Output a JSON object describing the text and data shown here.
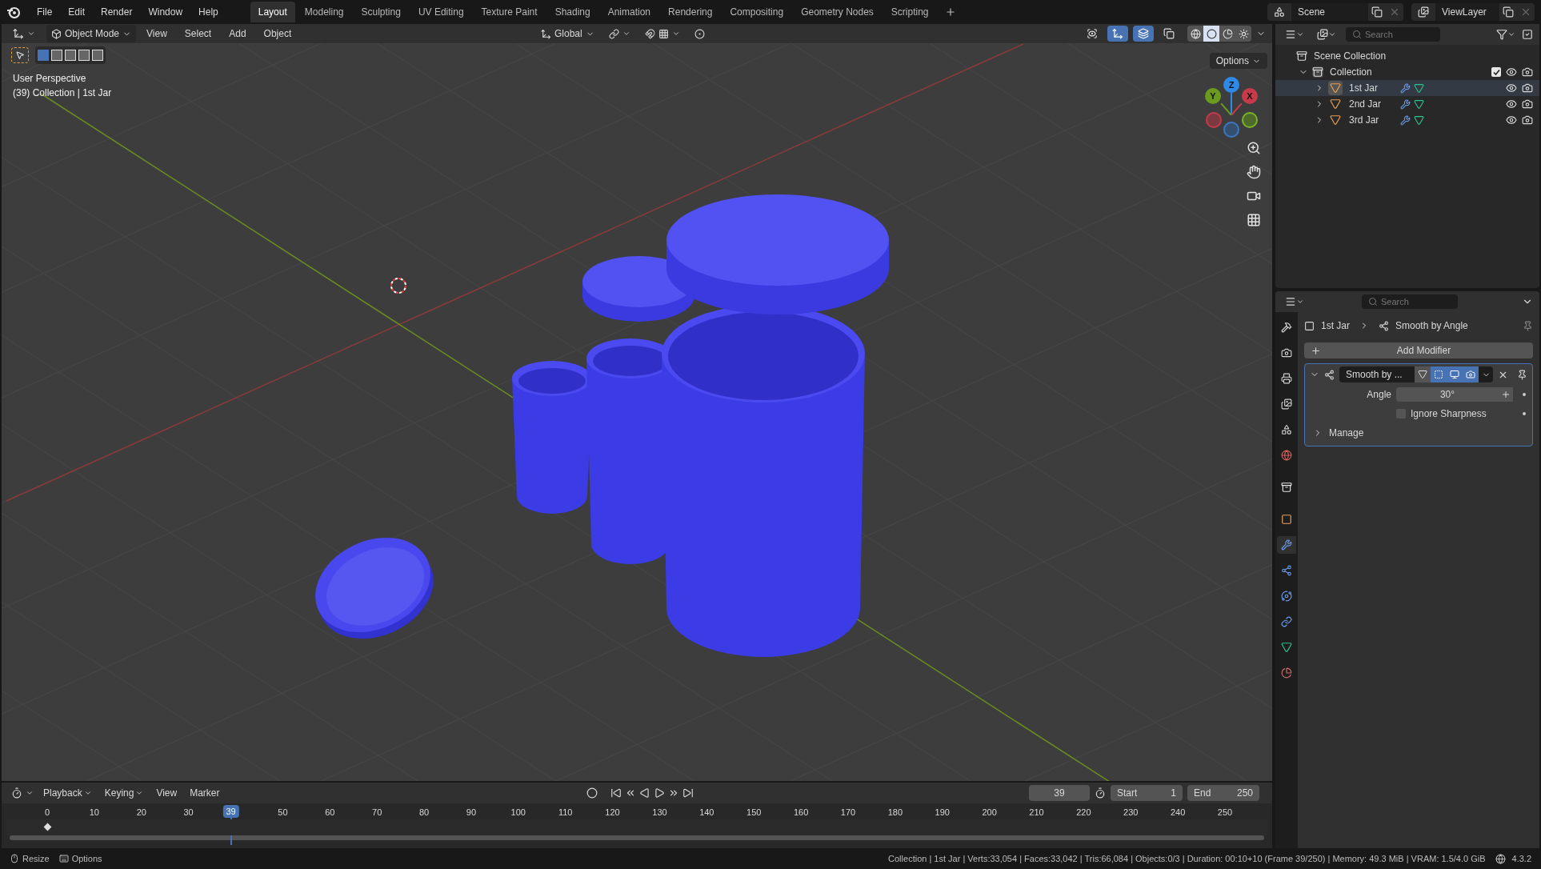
{
  "menu_bar": {
    "menus": [
      "File",
      "Edit",
      "Render",
      "Window",
      "Help"
    ],
    "workspaces": [
      {
        "label": "Layout",
        "selected": true
      },
      {
        "label": "Modeling",
        "selected": false
      },
      {
        "label": "Sculpting",
        "selected": false
      },
      {
        "label": "UV Editing",
        "selected": false
      },
      {
        "label": "Texture Paint",
        "selected": false
      },
      {
        "label": "Shading",
        "selected": false
      },
      {
        "label": "Animation",
        "selected": false
      },
      {
        "label": "Rendering",
        "selected": false
      },
      {
        "label": "Compositing",
        "selected": false
      },
      {
        "label": "Geometry Nodes",
        "selected": false
      },
      {
        "label": "Scripting",
        "selected": false
      }
    ],
    "scene": "Scene",
    "view_layer": "ViewLayer"
  },
  "viewport": {
    "mode": "Object Mode",
    "menus": [
      "View",
      "Select",
      "Add",
      "Object"
    ],
    "orientation": "Global",
    "header_toggles": [
      {
        "kind": "visibility",
        "on": false
      },
      {
        "kind": "gizmos",
        "on": true
      },
      {
        "kind": "overlays",
        "on": true
      },
      {
        "kind": "xray",
        "on": false
      }
    ],
    "shading": [
      {
        "kind": "wireframe",
        "selected": false
      },
      {
        "kind": "solid",
        "selected": true
      },
      {
        "kind": "material",
        "selected": false
      },
      {
        "kind": "rendered",
        "selected": false
      }
    ],
    "options": "Options",
    "view_name": "User Perspective",
    "view_info": "(39) Collection | 1st Jar",
    "gizmo": {
      "x": "X",
      "y": "Y",
      "z": "Z"
    }
  },
  "outliner": {
    "search": {
      "placeholder": "Search"
    },
    "tree": [
      {
        "label": "Scene Collection",
        "kind": "scene_collection",
        "children": [
          {
            "label": "Collection",
            "kind": "collection",
            "expanded": true,
            "checked": true,
            "children": [
              {
                "label": "1st Jar",
                "kind": "mesh",
                "expanded": false,
                "selected": true
              },
              {
                "label": "2nd Jar",
                "kind": "mesh",
                "expanded": false,
                "selected": false
              },
              {
                "label": "3rd Jar",
                "kind": "mesh",
                "expanded": false,
                "selected": false
              }
            ]
          }
        ]
      }
    ]
  },
  "properties": {
    "search": {
      "placeholder": "Search"
    },
    "tabs": [
      {
        "kind": "tool",
        "selected": false
      },
      {
        "kind": "render",
        "selected": false
      },
      {
        "kind": "output",
        "selected": false
      },
      {
        "kind": "view_layer",
        "selected": false
      },
      {
        "kind": "scene",
        "selected": false
      },
      {
        "kind": "world",
        "selected": false
      },
      {
        "kind": "collection",
        "selected": false
      },
      {
        "kind": "object",
        "selected": false
      },
      {
        "kind": "modifiers",
        "selected": true
      },
      {
        "kind": "particles",
        "selected": false
      },
      {
        "kind": "physics",
        "selected": false
      },
      {
        "kind": "constraints",
        "selected": false
      },
      {
        "kind": "data",
        "selected": false
      },
      {
        "kind": "material",
        "selected": false
      }
    ],
    "breadcrumb": {
      "object": "1st Jar",
      "modifier": "Smooth by Angle"
    },
    "add_modifier": "Add Modifier",
    "modifier": {
      "name": "Smooth by ...",
      "expanded": true,
      "toggles": [
        {
          "kind": "edit_cage",
          "on": false
        },
        {
          "kind": "edit_mode",
          "on": true
        },
        {
          "kind": "viewport",
          "on": true
        },
        {
          "kind": "render",
          "on": true
        }
      ],
      "angle": {
        "label": "Angle",
        "value": "30°"
      },
      "ignore_sharpness": {
        "label": "Ignore Sharpness",
        "checked": false
      },
      "manage": {
        "label": "Manage",
        "expanded": false
      }
    }
  },
  "timeline": {
    "menus": [
      "Playback",
      "Keying",
      "View",
      "Marker"
    ],
    "current_frame": "39",
    "start_label": "Start",
    "start": "1",
    "end_label": "End",
    "end": "250",
    "playhead": "39",
    "ticks": [
      "0",
      "10",
      "20",
      "30",
      "50",
      "60",
      "70",
      "80",
      "90",
      "100",
      "110",
      "120",
      "130",
      "140",
      "150",
      "160",
      "170",
      "180",
      "190",
      "200",
      "210",
      "220",
      "230",
      "240",
      "250"
    ]
  },
  "status_bar": {
    "hints": [
      {
        "kind": "mouse",
        "label": "Resize"
      },
      {
        "kind": "key",
        "label": "Options"
      }
    ],
    "stats": "Collection | 1st Jar | Verts:33,054 | Faces:33,042 | Tris:66,084 | Objects:0/3 | Duration: 00:10+10 (Frame 39/250) | Memory: 49.3 MiB | VRAM: 1.5/4.0 GiB",
    "version": "4.3.2"
  }
}
